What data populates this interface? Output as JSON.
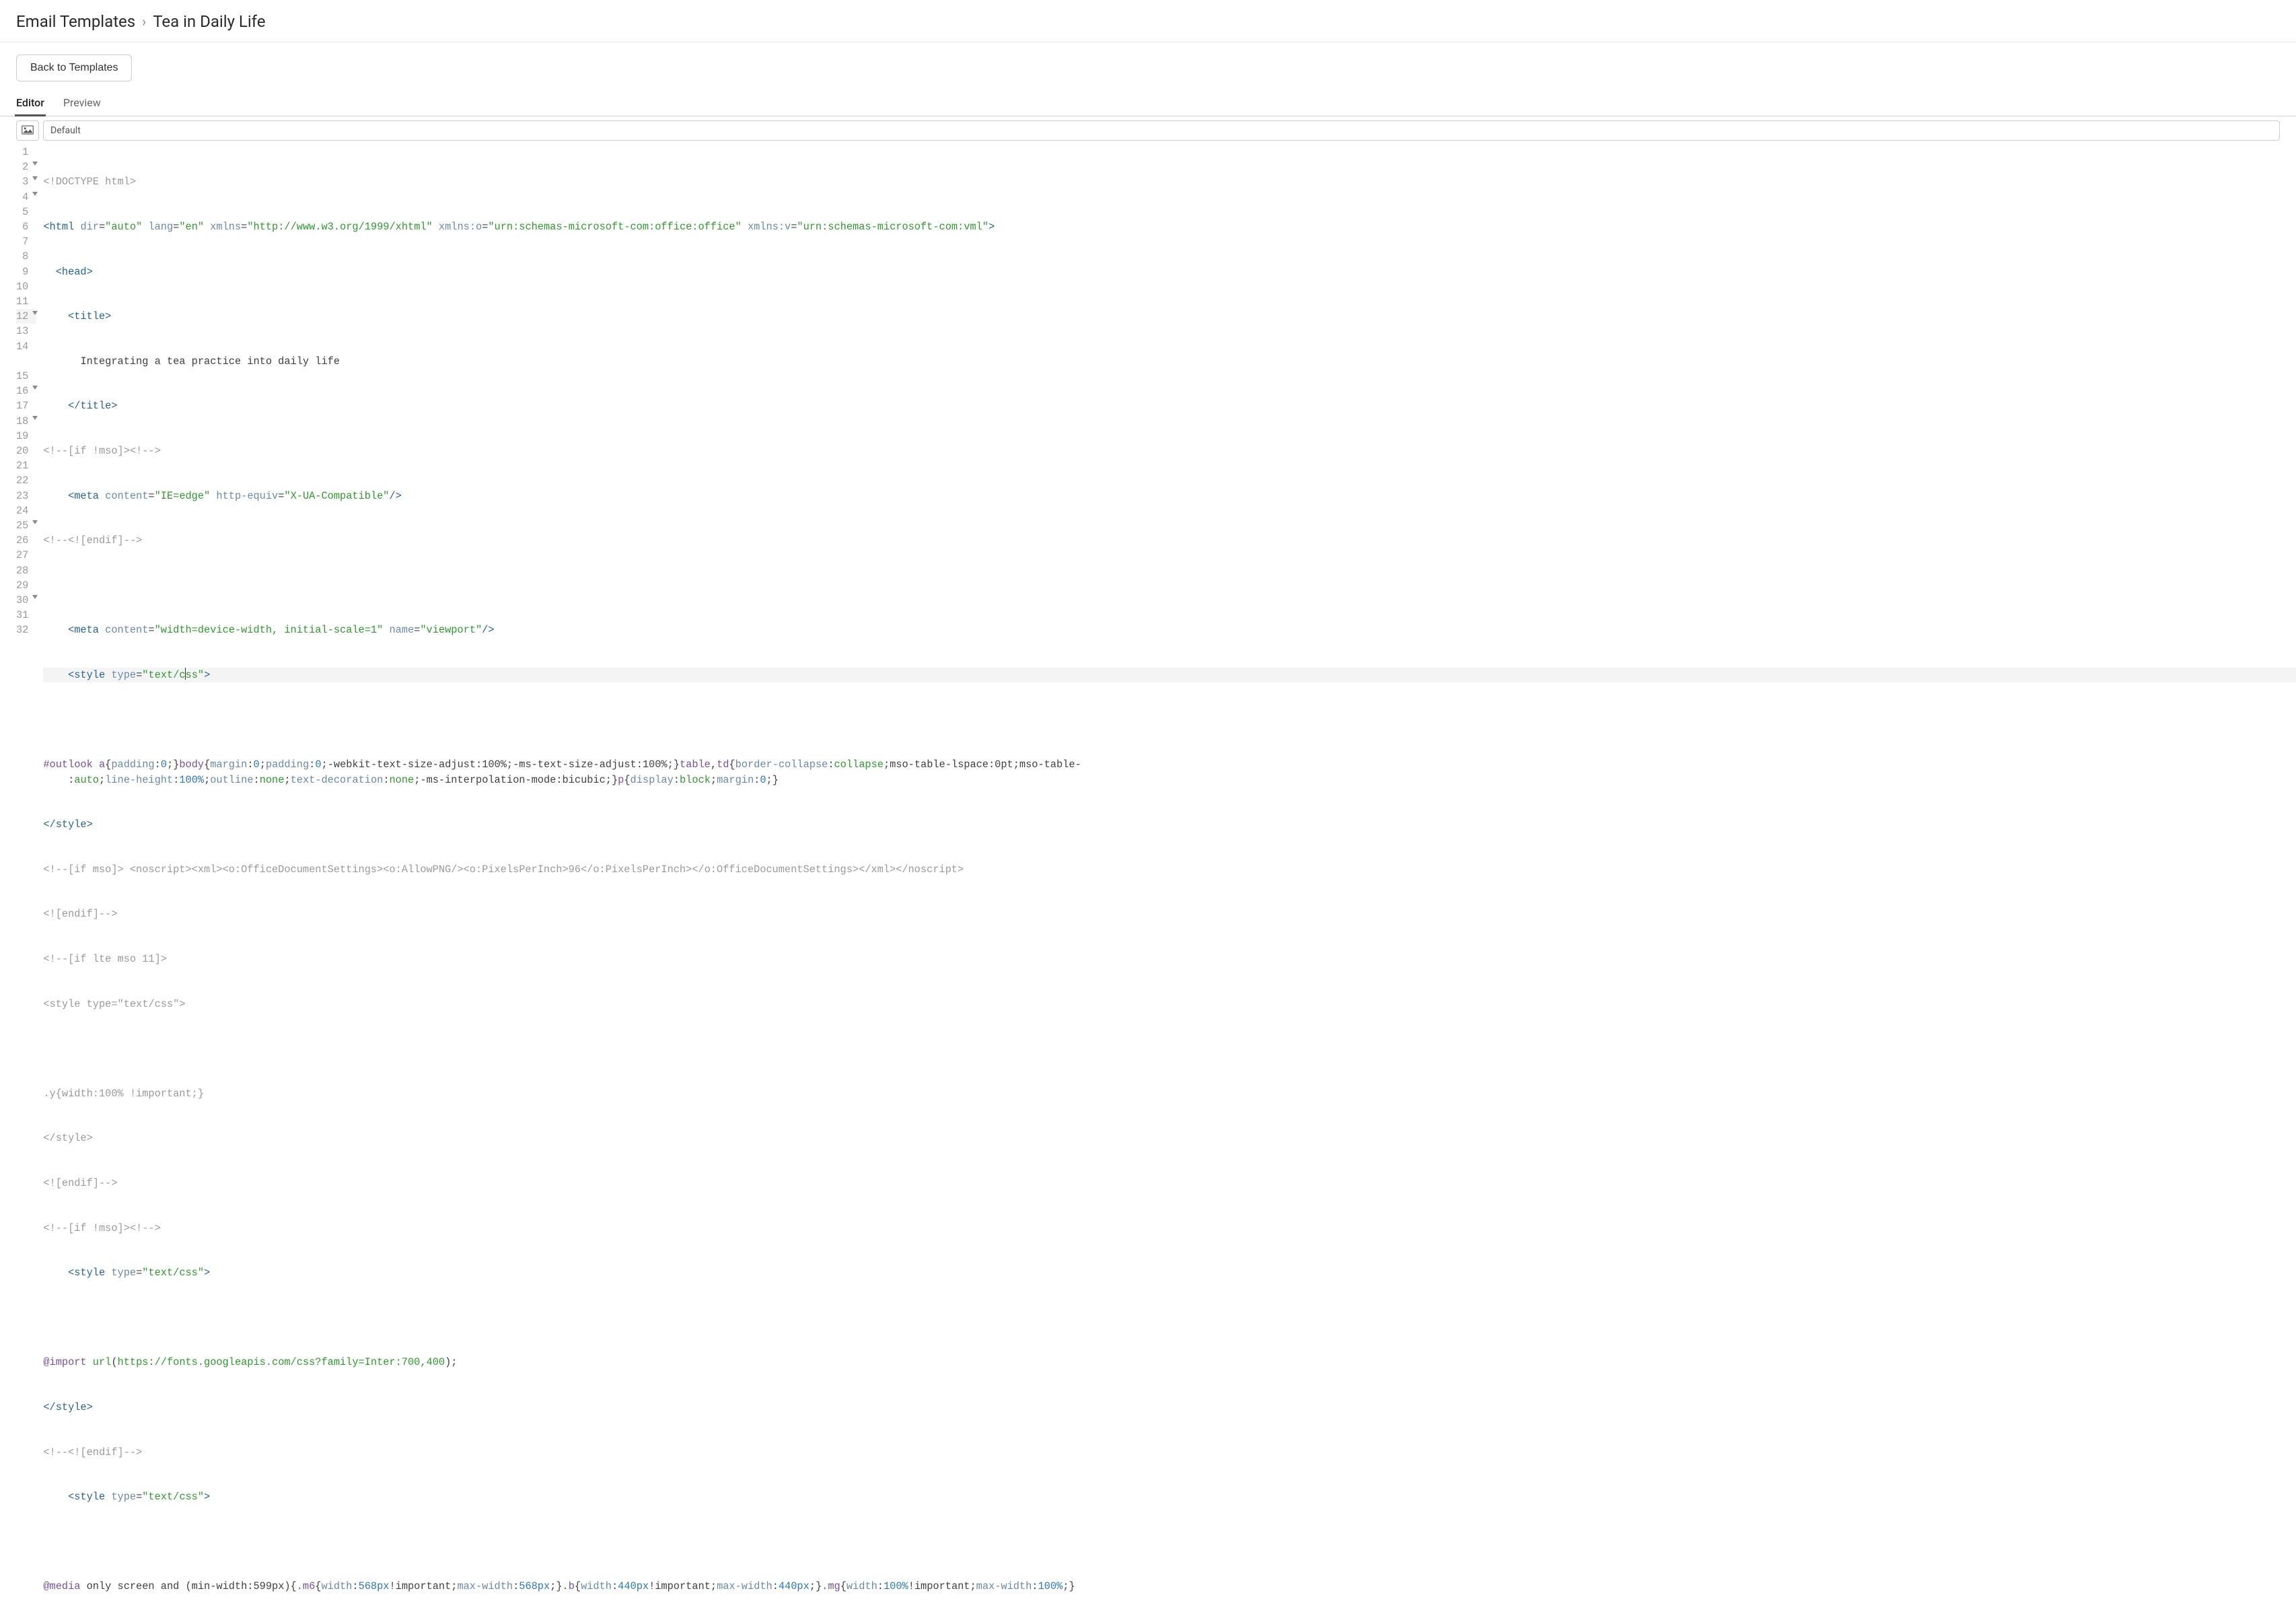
{
  "breadcrumb": {
    "root": "Email Templates",
    "current": "Tea in Daily Life"
  },
  "toolbar": {
    "back_label": "Back to Templates"
  },
  "tabs": {
    "editor": "Editor",
    "preview": "Preview"
  },
  "editor_toolbar": {
    "image_icon": "image",
    "theme": "Default"
  },
  "active_line": 12,
  "code": {
    "lines": [
      {
        "n": 1,
        "fold": false
      },
      {
        "n": 2,
        "fold": true
      },
      {
        "n": 3,
        "fold": true
      },
      {
        "n": 4,
        "fold": true
      },
      {
        "n": 5,
        "fold": false
      },
      {
        "n": 6,
        "fold": false
      },
      {
        "n": 7,
        "fold": false
      },
      {
        "n": 8,
        "fold": false
      },
      {
        "n": 9,
        "fold": false
      },
      {
        "n": 10,
        "fold": false
      },
      {
        "n": 11,
        "fold": false
      },
      {
        "n": 12,
        "fold": true
      },
      {
        "n": 13,
        "fold": false
      },
      {
        "n": 14,
        "fold": false
      },
      {
        "n": 15,
        "fold": false
      },
      {
        "n": 16,
        "fold": true
      },
      {
        "n": 17,
        "fold": false
      },
      {
        "n": 18,
        "fold": true
      },
      {
        "n": 19,
        "fold": false
      },
      {
        "n": 20,
        "fold": false
      },
      {
        "n": 21,
        "fold": false
      },
      {
        "n": 22,
        "fold": false
      },
      {
        "n": 23,
        "fold": false
      },
      {
        "n": 24,
        "fold": false
      },
      {
        "n": 25,
        "fold": true
      },
      {
        "n": 26,
        "fold": false
      },
      {
        "n": 27,
        "fold": false
      },
      {
        "n": 28,
        "fold": false
      },
      {
        "n": 29,
        "fold": false
      },
      {
        "n": 30,
        "fold": true
      },
      {
        "n": 31,
        "fold": false
      },
      {
        "n": 32,
        "fold": false
      }
    ],
    "l1": {
      "doctype": "<!DOCTYPE html>"
    },
    "l2": {
      "open": "<html ",
      "a1": "dir",
      "v1": "\"auto\"",
      "a2": "lang",
      "v2": "\"en\"",
      "a3": "xmlns",
      "v3": "\"http://www.w3.org/1999/xhtml\"",
      "a4": "xmlns:o",
      "v4": "\"urn:schemas-microsoft-com:office:office\"",
      "a5": "xmlns:v",
      "v5": "\"urn:schemas-microsoft-com:vml\"",
      "close": ">"
    },
    "l3": {
      "tag": "<head>"
    },
    "l4": {
      "tag": "<title>"
    },
    "l5": {
      "text": "Integrating a tea practice into daily life"
    },
    "l6": {
      "tag": "</title>"
    },
    "l7": {
      "cmt": "<!--[if !mso]><!-->"
    },
    "l8": {
      "open": "<meta ",
      "a1": "content",
      "v1": "\"IE=edge\"",
      "a2": "http-equiv",
      "v2": "\"X-UA-Compatible\"",
      "close": "/>"
    },
    "l9": {
      "cmt": "<!--<![endif]-->"
    },
    "l11": {
      "open": "<meta ",
      "a1": "content",
      "v1": "\"width=device-width, initial-scale=1\"",
      "a2": "name",
      "v2": "\"viewport\"",
      "close": "/>"
    },
    "l12": {
      "open": "<style ",
      "a1": "type",
      "v1": "\"text/css\"",
      "close": ">"
    },
    "l14": {
      "sel1": "#outlook a",
      "p1": "padding",
      "n1": "0",
      "sel2": "body",
      "p2a": "margin",
      "n2a": "0",
      "p2b": "padding",
      "n2b": "0",
      "t2c": ";-webkit-text-size-adjust:100%;-ms-text-size-adjust:100%;",
      "sel3": "table",
      "sel3b": "td",
      "p3": "border-collapse",
      "v3": "collapse",
      "t3": ";mso-table-lspace:0pt;mso-table-",
      "wrap_t1": ":",
      "wrap_v1": "auto",
      "wrap_p2": "line-height",
      "wrap_n2": "100%",
      "wrap_p3": "outline",
      "wrap_v3": "none",
      "wrap_p4": "text-decoration",
      "wrap_v4": "none",
      "wrap_t5": ";-ms-interpolation-mode:bicubic;",
      "sel4": "p",
      "p4a": "display",
      "v4a": "block",
      "p4b": "margin",
      "n4b": "0"
    },
    "l15": {
      "tag": "</style>"
    },
    "l16": {
      "cmt": "<!--[if mso]> <noscript><xml><o:OfficeDocumentSettings><o:AllowPNG/><o:PixelsPerInch>96</o:PixelsPerInch></o:OfficeDocumentSettings></xml></noscript>"
    },
    "l17": {
      "cmt": "<![endif]-->"
    },
    "l18": {
      "cmt": "<!--[if lte mso 11]>"
    },
    "l19": {
      "text": "<style type=\"text/css\">"
    },
    "l21": {
      "text": ".y{width:100% !important;}"
    },
    "l22": {
      "text": "</style>"
    },
    "l23": {
      "cmt": "<![endif]-->"
    },
    "l24": {
      "cmt": "<!--[if !mso]><!-->"
    },
    "l25": {
      "open": "<style ",
      "a1": "type",
      "v1": "\"text/css\"",
      "close": ">"
    },
    "l27": {
      "kw": "@import ",
      "fn": "url",
      "paren_o": "(",
      "url": "https://fonts.googleapis.com/css?family=Inter:700,400",
      "paren_c": ");"
    },
    "l28": {
      "tag": "</style>"
    },
    "l29": {
      "cmt": "<!--<![endif]-->"
    },
    "l30": {
      "open": "<style ",
      "a1": "type",
      "v1": "\"text/css\"",
      "close": ">"
    },
    "l32": {
      "kw": "@media ",
      "t1": "only screen and (min-width:599px){",
      "sel1": ".m6",
      "p1a": "width",
      "n1a": "568px",
      "imp": "!important;",
      "p1b": "max-width",
      "n1b": "568px",
      "t1e": ";}",
      "sel2": ".b",
      "p2a": "width",
      "n2a": "440px",
      "p2b": "max-width",
      "n2b": "440px",
      "sel3": ".mg",
      "p3a": "width",
      "n3a": "100%",
      "p3b": "max-width",
      "n3b": "100%",
      "t3e": ";}"
    }
  }
}
